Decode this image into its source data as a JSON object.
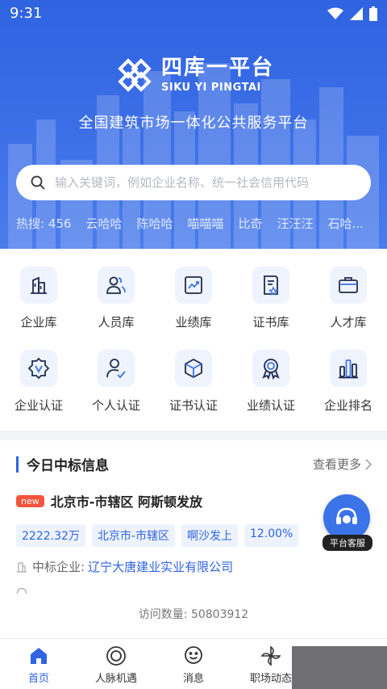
{
  "status_bar": {
    "time": "9:31"
  },
  "header": {
    "logo_title": "四库一平台",
    "logo_subtitle": "SIKU YI PINGTAI",
    "tagline": "全国建筑市场一体化公共服务平台"
  },
  "search": {
    "placeholder": "输入关键词，例如企业名称、统一社会信用代码"
  },
  "hot_search": {
    "label": "热搜: 456",
    "items": [
      "云哈哈",
      "陈哈哈",
      "喵喵喵",
      "比奇",
      "汪汪汪",
      "石哈..."
    ]
  },
  "categories": [
    {
      "label": "企业库",
      "icon": "building-icon"
    },
    {
      "label": "人员库",
      "icon": "people-icon"
    },
    {
      "label": "业绩库",
      "icon": "chart-up-icon"
    },
    {
      "label": "证书库",
      "icon": "certificate-icon"
    },
    {
      "label": "人才库",
      "icon": "briefcase-icon"
    },
    {
      "label": "企业认证",
      "icon": "badge-v-icon"
    },
    {
      "label": "个人认证",
      "icon": "person-check-icon"
    },
    {
      "label": "证书认证",
      "icon": "cube-icon"
    },
    {
      "label": "业绩认证",
      "icon": "award-icon"
    },
    {
      "label": "企业排名",
      "icon": "bar-chart-icon"
    }
  ],
  "bid": {
    "section_title": "今日中标信息",
    "more_label": "查看更多",
    "new_badge": "new",
    "item_title": "北京市-市辖区 阿斯顿发放",
    "tags": [
      "2222.32万",
      "北京市-市辖区",
      "啊沙发上",
      "12.00%"
    ],
    "winner_label": "中标企业:",
    "winner_value": "辽宁大唐建业实业有限公司",
    "visits_label": "访问数量: 50803912"
  },
  "customer_service": {
    "label": "平台客服"
  },
  "tabbar": {
    "items": [
      {
        "label": "首页",
        "icon": "home-icon"
      },
      {
        "label": "人脉机遇",
        "icon": "circle-target-icon"
      },
      {
        "label": "消息",
        "icon": "smile-chat-icon"
      },
      {
        "label": "职场动态",
        "icon": "pinwheel-icon"
      }
    ]
  },
  "colors": {
    "primary": "#2f63e0",
    "badge": "#f4543c"
  }
}
